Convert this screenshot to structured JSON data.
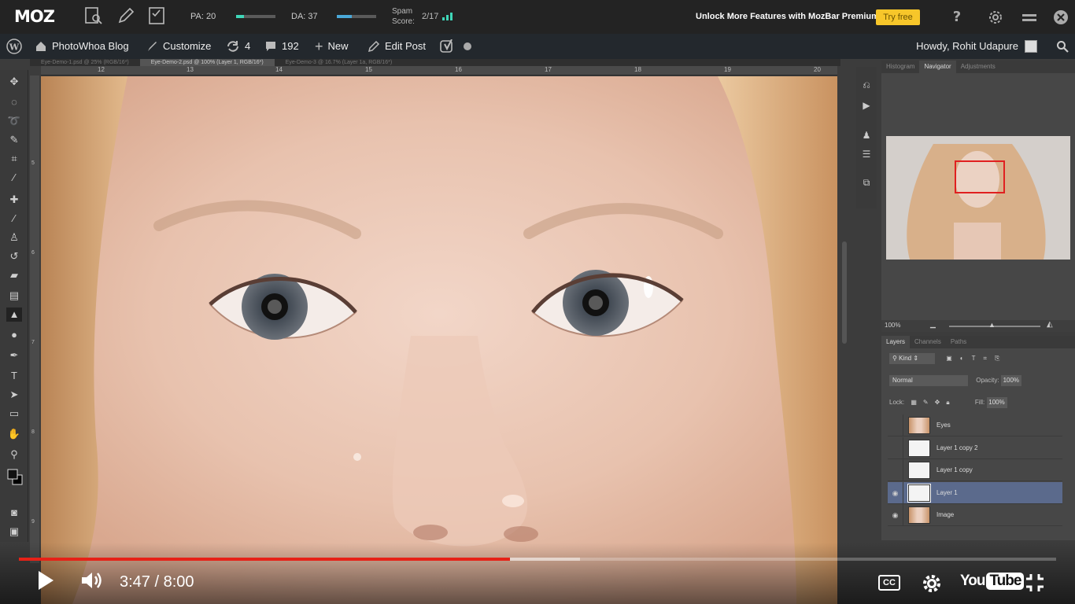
{
  "mozbar": {
    "logo": "MOZ",
    "pa_label": "PA: 20",
    "pa_fraction": 0.2,
    "da_label": "DA: 37",
    "da_fraction": 0.37,
    "spam_label_line1": "Spam",
    "spam_label_line2": "Score:",
    "spam_value": "2/17",
    "unlock_text": "Unlock More Features with MozBar Premium",
    "try_free": "Try free",
    "accent_color": "#f7c62a",
    "pa_bar_color": "#3fd6b8",
    "da_bar_color": "#4aa8d8"
  },
  "wpbar": {
    "site_name": "PhotoWhoa Blog",
    "customize": "Customize",
    "updates_count": "4",
    "comments_count": "192",
    "new_label": "New",
    "edit_post": "Edit Post",
    "howdy": "Howdy, Rohit Udapure"
  },
  "photoshop": {
    "tabs": [
      "Eye-Demo-1.psd @ 25% (RGB/16*)",
      "Eye-Demo-2.psd @ 100% (Layer 1, RGB/16*)",
      "Eye-Demo-3 @ 16.7% (Layer 1a, RGB/16*)"
    ],
    "ruler_h": [
      "12",
      "13",
      "14",
      "15",
      "16",
      "17",
      "18",
      "19",
      "20"
    ],
    "ruler_v": [
      "5",
      "6",
      "7",
      "8",
      "9"
    ],
    "panel_tabs_top": [
      "Histogram",
      "Navigator",
      "Adjustments"
    ],
    "zoom_value": "100%",
    "panel_tabs_layers": [
      "Layers",
      "Channels",
      "Paths"
    ],
    "filter_kind": "Kind",
    "blend_mode": "Normal",
    "opacity_label": "Opacity:",
    "opacity_value": "100%",
    "lock_label": "Lock:",
    "fill_label": "Fill:",
    "fill_value": "100%",
    "layers": [
      {
        "name": "Eyes",
        "visible": false,
        "selected": false,
        "thumb": "photo"
      },
      {
        "name": "Layer 1 copy 2",
        "visible": false,
        "selected": false,
        "thumb": "white"
      },
      {
        "name": "Layer 1 copy",
        "visible": false,
        "selected": false,
        "thumb": "white"
      },
      {
        "name": "Layer 1",
        "visible": true,
        "selected": true,
        "thumb": "white"
      },
      {
        "name": "Image",
        "visible": true,
        "selected": false,
        "thumb": "photo"
      }
    ],
    "selected_layer_color": "#5b6a8c"
  },
  "youtube": {
    "time_display": "3:47 / 8:00",
    "played_fraction": 0.4731,
    "buffered_fraction": 0.541,
    "progress_color": "#e62117",
    "cc_label": "CC",
    "logo_you": "You",
    "logo_tube": "Tube"
  }
}
